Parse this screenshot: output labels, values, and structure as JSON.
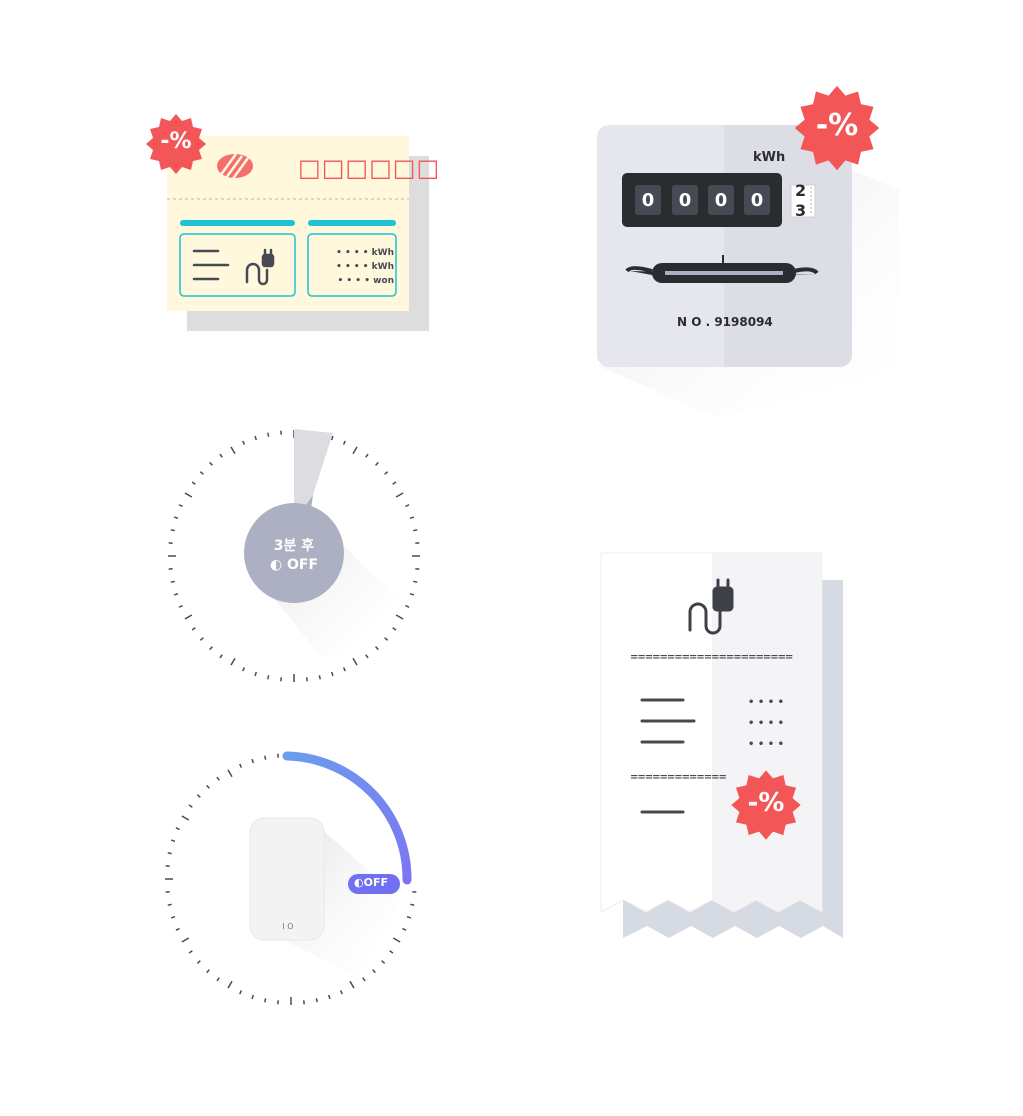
{
  "colors": {
    "accent_red": "#F25656",
    "teal": "#1CC3D3",
    "paper_cream": "#FFF8DD",
    "meter_gray": "#E6E7EE",
    "dark": "#2B2C30",
    "timer_gray": "#ADB0C2",
    "gradient_blue": "#6A9DED",
    "gradient_violet": "#7D76F2"
  },
  "badge": {
    "text": "-%"
  },
  "bill": {
    "title_boxes": [
      "□",
      "□",
      "□",
      "□",
      "□",
      "□"
    ],
    "dots": "• • • •",
    "units": [
      "kWh",
      "kWh",
      "won"
    ],
    "icons": [
      "logo-stripes-icon",
      "lines-icon",
      "plug-icon"
    ]
  },
  "meter": {
    "unit_label": "kWh",
    "digits": [
      "0",
      "0",
      "0",
      "0"
    ],
    "roller_digits": [
      "2",
      "3"
    ],
    "serial": "N O . 9198094"
  },
  "timer": {
    "label_line1": "3분 후",
    "label_line2": "OFF",
    "icons": [
      "moon-icon"
    ]
  },
  "switch_timer": {
    "toggle_label": "OFF",
    "device_label": "I O",
    "icons": [
      "moon-icon",
      "smart-plug-icon"
    ]
  },
  "receipt": {
    "separator_long": "======================",
    "separator_short": "=============",
    "dots": "• • • •",
    "icons": [
      "plug-icon",
      "lines-icon"
    ]
  }
}
